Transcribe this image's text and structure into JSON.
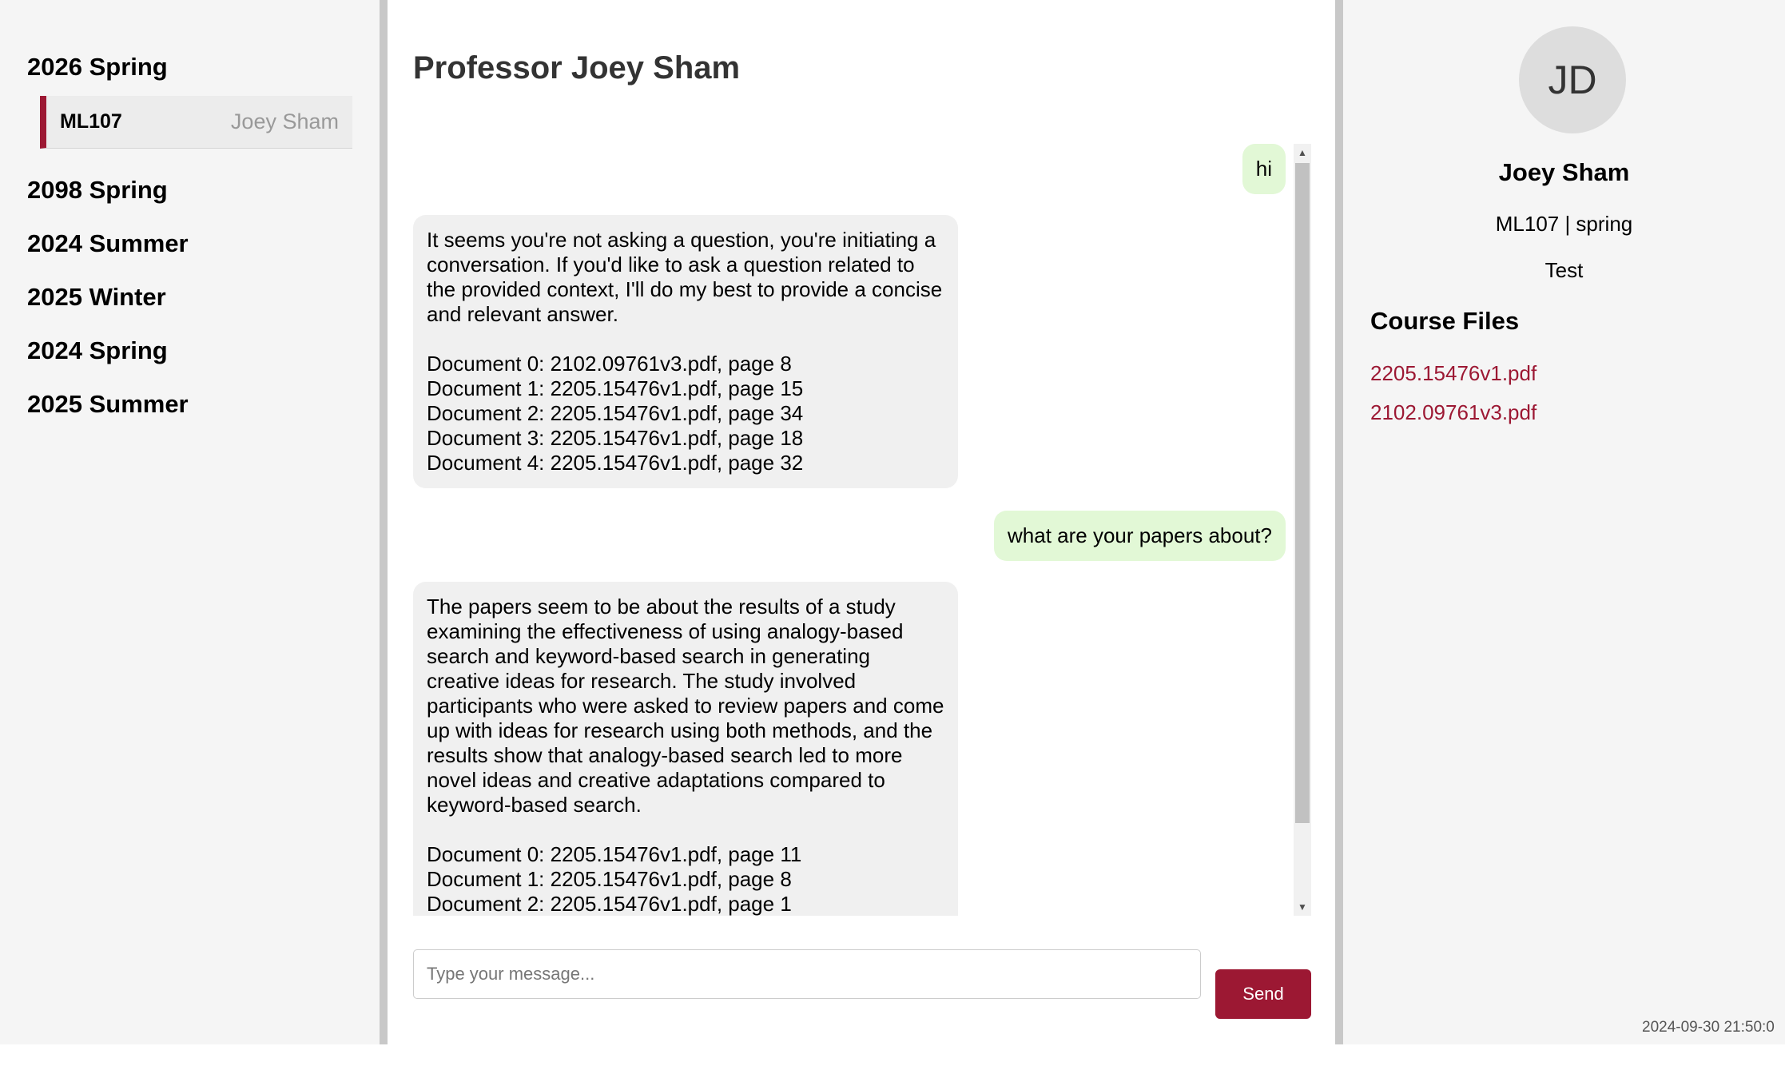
{
  "sidebar": {
    "terms": [
      {
        "label": "2026 Spring"
      },
      {
        "label": "2098 Spring"
      },
      {
        "label": "2024 Summer"
      },
      {
        "label": "2025 Winter"
      },
      {
        "label": "2024 Spring"
      },
      {
        "label": "2025 Summer"
      }
    ],
    "open_term_courses": [
      {
        "code": "ML107",
        "professor": "Joey Sham"
      }
    ]
  },
  "chat": {
    "title": "Professor Joey Sham",
    "messages": [
      {
        "role": "user",
        "text": "hi"
      },
      {
        "role": "bot",
        "text": "It seems you're not asking a question, you're initiating a conversation. If you'd like to ask a question related to the provided context, I'll do my best to provide a concise and relevant answer.\n\nDocument 0: 2102.09761v3.pdf, page 8\nDocument 1: 2205.15476v1.pdf, page 15\nDocument 2: 2205.15476v1.pdf, page 34\nDocument 3: 2205.15476v1.pdf, page 18\nDocument 4: 2205.15476v1.pdf, page 32"
      },
      {
        "role": "user",
        "text": "what are your papers about?"
      },
      {
        "role": "bot",
        "text": "The papers seem to be about the results of a study examining the effectiveness of using analogy-based search and keyword-based search in generating creative ideas for research. The study involved participants who were asked to review papers and come up with ideas for research using both methods, and the results show that analogy-based search led to more novel ideas and creative adaptations compared to keyword-based search.\n\nDocument 0: 2205.15476v1.pdf, page 11\nDocument 1: 2205.15476v1.pdf, page 8\nDocument 2: 2205.15476v1.pdf, page 1"
      }
    ],
    "input_placeholder": "Type your message...",
    "send_label": "Send"
  },
  "profile": {
    "initials": "JD",
    "name": "Joey Sham",
    "course": "ML107 | spring",
    "description": "Test",
    "files_title": "Course Files",
    "files": [
      "2205.15476v1.pdf",
      "2102.09761v3.pdf"
    ]
  },
  "footer": {
    "timestamp": "2024-09-30 21:50:0"
  },
  "colors": {
    "accent": "#9c1833",
    "user_bubble": "#e2f8d6",
    "bot_bubble": "#f0f0f0",
    "panel_bg": "#f5f5f5"
  }
}
